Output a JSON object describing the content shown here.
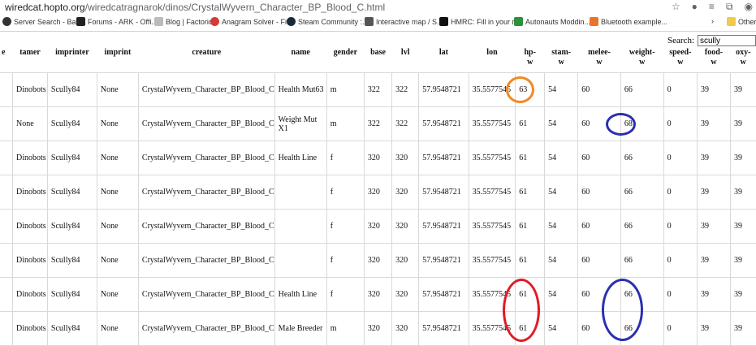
{
  "browser": {
    "url_host": "wiredcat.hopto.org",
    "url_path": "/wiredcatragnarok/dinos/CrystalWyvern_Character_BP_Blood_C.html",
    "bookmarks": [
      {
        "label": "Server Search - Batt...",
        "color": "#333333"
      },
      {
        "label": "Forums - ARK - Offi...",
        "color": "#222222"
      },
      {
        "label": "Blog | Factorio",
        "color": "#aaaaaa"
      },
      {
        "label": "Anagram Solver - Fi...",
        "color": "#d23a3a"
      },
      {
        "label": "Steam Community :...",
        "color": "#1b2838"
      },
      {
        "label": "Interactive map / S...",
        "color": "#555555"
      },
      {
        "label": "HMRC: Fill in your r...",
        "color": "#111111"
      },
      {
        "label": "Autonauts Moddin...",
        "color": "#2f8f3a"
      },
      {
        "label": "Bluetooth example...",
        "color": "#e8742a"
      }
    ],
    "other_bookmarks": "Other"
  },
  "search": {
    "label": "Search:",
    "value": "scully"
  },
  "table": {
    "columns": [
      "e",
      "tamer",
      "imprinter",
      "imprint",
      "creature",
      "name",
      "gender",
      "base",
      "lvl",
      "lat",
      "lon",
      "hp-\nw",
      "stam-\nw",
      "melee-\nw",
      "weight-\nw",
      "speed-\nw",
      "food-\nw",
      "oxy-\nw"
    ],
    "rows": [
      {
        "tamer": "Dinobots",
        "imprinter": "Scully84",
        "imprint": "None",
        "creature": "CrystalWyvern_Character_BP_Blood_C",
        "name": "Health Mut63",
        "gender": "m",
        "base": "322",
        "lvl": "322",
        "lat": "57.9548721",
        "lon": "35.5577545",
        "hp": "63",
        "stam": "54",
        "melee": "60",
        "weight": "66",
        "speed": "0",
        "food": "39",
        "oxy": "39"
      },
      {
        "tamer": "None",
        "imprinter": "Scully84",
        "imprint": "None",
        "creature": "CrystalWyvern_Character_BP_Blood_C",
        "name": "Weight Mut X1",
        "gender": "m",
        "base": "322",
        "lvl": "322",
        "lat": "57.9548721",
        "lon": "35.5577545",
        "hp": "61",
        "stam": "54",
        "melee": "60",
        "weight": "68",
        "speed": "0",
        "food": "39",
        "oxy": "39"
      },
      {
        "tamer": "Dinobots",
        "imprinter": "Scully84",
        "imprint": "None",
        "creature": "CrystalWyvern_Character_BP_Blood_C",
        "name": "Health Line",
        "gender": "f",
        "base": "320",
        "lvl": "320",
        "lat": "57.9548721",
        "lon": "35.5577545",
        "hp": "61",
        "stam": "54",
        "melee": "60",
        "weight": "66",
        "speed": "0",
        "food": "39",
        "oxy": "39"
      },
      {
        "tamer": "Dinobots",
        "imprinter": "Scully84",
        "imprint": "None",
        "creature": "CrystalWyvern_Character_BP_Blood_C",
        "name": "",
        "gender": "f",
        "base": "320",
        "lvl": "320",
        "lat": "57.9548721",
        "lon": "35.5577545",
        "hp": "61",
        "stam": "54",
        "melee": "60",
        "weight": "66",
        "speed": "0",
        "food": "39",
        "oxy": "39"
      },
      {
        "tamer": "Dinobots",
        "imprinter": "Scully84",
        "imprint": "None",
        "creature": "CrystalWyvern_Character_BP_Blood_C",
        "name": "",
        "gender": "f",
        "base": "320",
        "lvl": "320",
        "lat": "57.9548721",
        "lon": "35.5577545",
        "hp": "61",
        "stam": "54",
        "melee": "60",
        "weight": "66",
        "speed": "0",
        "food": "39",
        "oxy": "39"
      },
      {
        "tamer": "Dinobots",
        "imprinter": "Scully84",
        "imprint": "None",
        "creature": "CrystalWyvern_Character_BP_Blood_C",
        "name": "",
        "gender": "f",
        "base": "320",
        "lvl": "320",
        "lat": "57.9548721",
        "lon": "35.5577545",
        "hp": "61",
        "stam": "54",
        "melee": "60",
        "weight": "66",
        "speed": "0",
        "food": "39",
        "oxy": "39"
      },
      {
        "tamer": "Dinobots",
        "imprinter": "Scully84",
        "imprint": "None",
        "creature": "CrystalWyvern_Character_BP_Blood_C",
        "name": "Health Line",
        "gender": "f",
        "base": "320",
        "lvl": "320",
        "lat": "57.9548721",
        "lon": "35.5577545",
        "hp": "61",
        "stam": "54",
        "melee": "60",
        "weight": "66",
        "speed": "0",
        "food": "39",
        "oxy": "39"
      },
      {
        "tamer": "Dinobots",
        "imprinter": "Scully84",
        "imprint": "None",
        "creature": "CrystalWyvern_Character_BP_Blood_C",
        "name": "Male Breeder",
        "gender": "m",
        "base": "320",
        "lvl": "320",
        "lat": "57.9548721",
        "lon": "35.5577545",
        "hp": "61",
        "stam": "54",
        "melee": "60",
        "weight": "66",
        "speed": "0",
        "food": "39",
        "oxy": "39"
      }
    ]
  },
  "annotations": {
    "orange": "#f08a24",
    "blue": "#2b2fb0",
    "red": "#e01b24"
  }
}
